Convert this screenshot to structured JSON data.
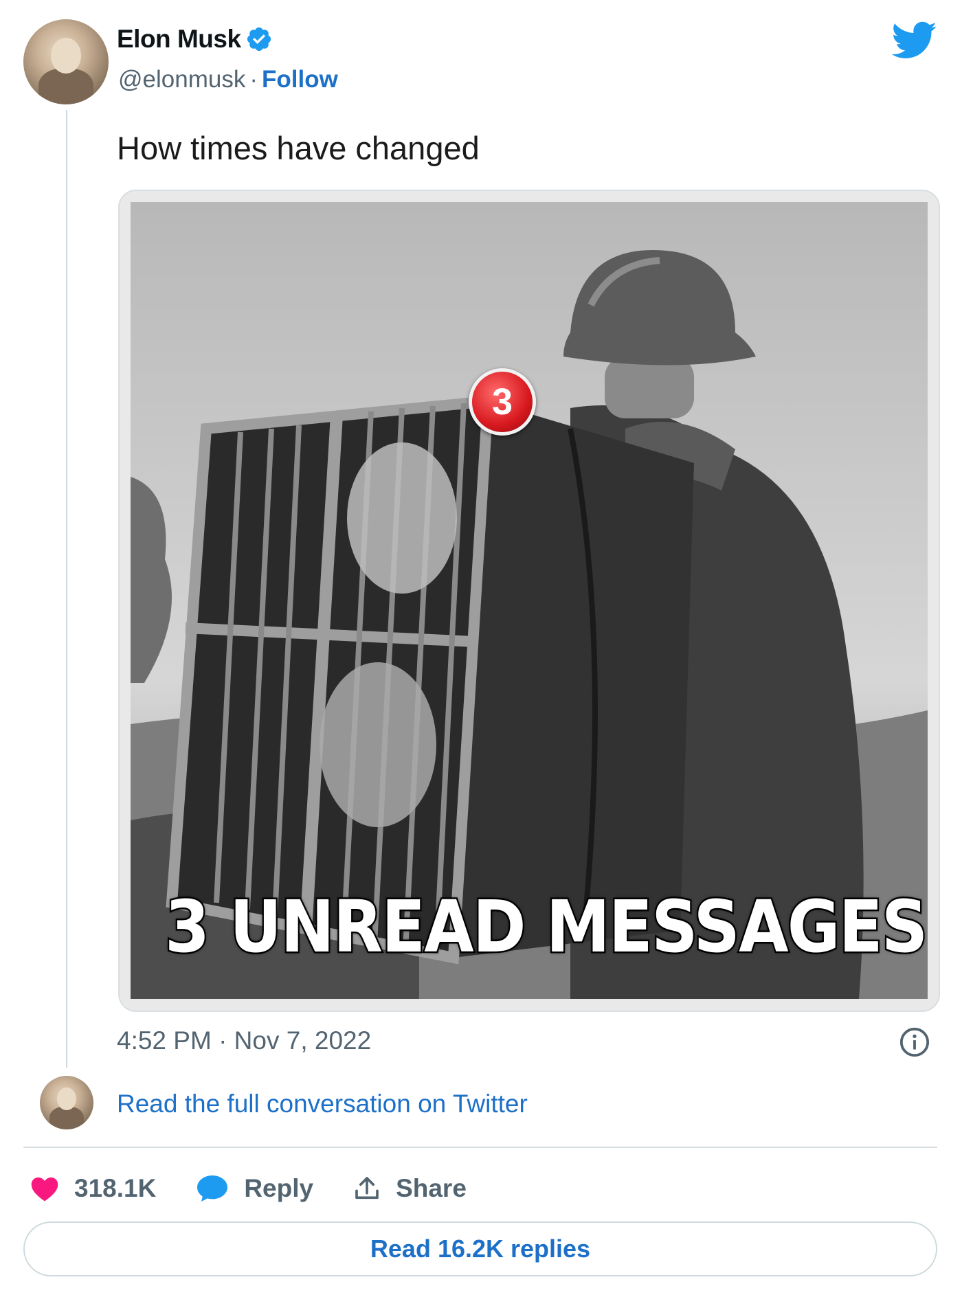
{
  "author": {
    "display_name": "Elon Musk",
    "handle": "@elonmusk",
    "separator": "·",
    "follow_label": "Follow",
    "verified": true
  },
  "tweet": {
    "text": "How times have changed",
    "timestamp": "4:52 PM · Nov 7, 2022"
  },
  "media": {
    "caption": "3 UNREAD MESSAGES",
    "badge_count": "3"
  },
  "conversation": {
    "link_label": "Read the full conversation on Twitter"
  },
  "actions": {
    "likes": "318.1K",
    "reply_label": "Reply",
    "share_label": "Share"
  },
  "replies_button": {
    "label": "Read 16.2K replies"
  },
  "colors": {
    "link_blue": "#1d70c8",
    "twitter_blue": "#1d9bf0",
    "like_pink": "#f91880",
    "muted_gray": "#536471"
  },
  "icons": [
    "twitter-bird-icon",
    "verified-badge-icon",
    "info-icon",
    "heart-icon",
    "speech-bubble-icon",
    "share-arrow-icon"
  ]
}
